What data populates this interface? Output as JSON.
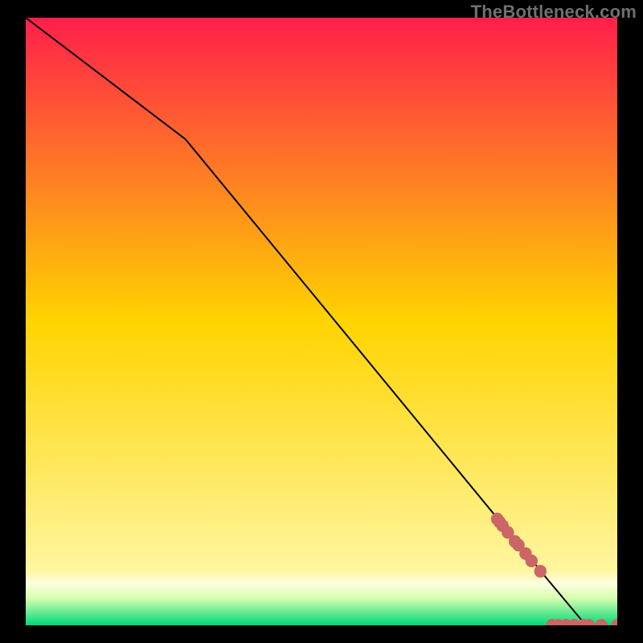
{
  "attribution": "TheBottleneck.com",
  "colors": {
    "frame": "#000000",
    "line": "#000000",
    "marker": "#cc6666",
    "gradient_top": "#ff1f4b",
    "gradient_mid": "#ffd400",
    "gradient_green_band_top": "#d7ffb0",
    "gradient_green": "#00d977"
  },
  "chart_data": {
    "type": "line",
    "title": "",
    "xlabel": "",
    "ylabel": "",
    "xlim": [
      0,
      100
    ],
    "ylim": [
      0,
      100
    ],
    "grid": false,
    "legend": false,
    "line_path": [
      {
        "x": 0,
        "y": 100
      },
      {
        "x": 27,
        "y": 80
      },
      {
        "x": 86,
        "y": 10.2
      },
      {
        "x": 88,
        "y": 7.8
      },
      {
        "x": 94.7,
        "y": 0.0
      }
    ],
    "markers": [
      {
        "x": 79.7,
        "y": 17.5
      },
      {
        "x": 80.1,
        "y": 17.0
      },
      {
        "x": 80.6,
        "y": 16.4
      },
      {
        "x": 81.5,
        "y": 15.3
      },
      {
        "x": 82.7,
        "y": 13.8
      },
      {
        "x": 83.3,
        "y": 13.2
      },
      {
        "x": 84.5,
        "y": 11.8
      },
      {
        "x": 85.5,
        "y": 10.6
      },
      {
        "x": 87.0,
        "y": 8.9
      },
      {
        "x": 89.0,
        "y": 0.0
      },
      {
        "x": 90.0,
        "y": 0.0
      },
      {
        "x": 91.3,
        "y": 0.0
      },
      {
        "x": 92.7,
        "y": 0.0
      },
      {
        "x": 94.3,
        "y": 0.0
      },
      {
        "x": 95.2,
        "y": 0.0
      },
      {
        "x": 97.3,
        "y": 0.0
      },
      {
        "x": 100.0,
        "y": 0.0
      }
    ]
  }
}
